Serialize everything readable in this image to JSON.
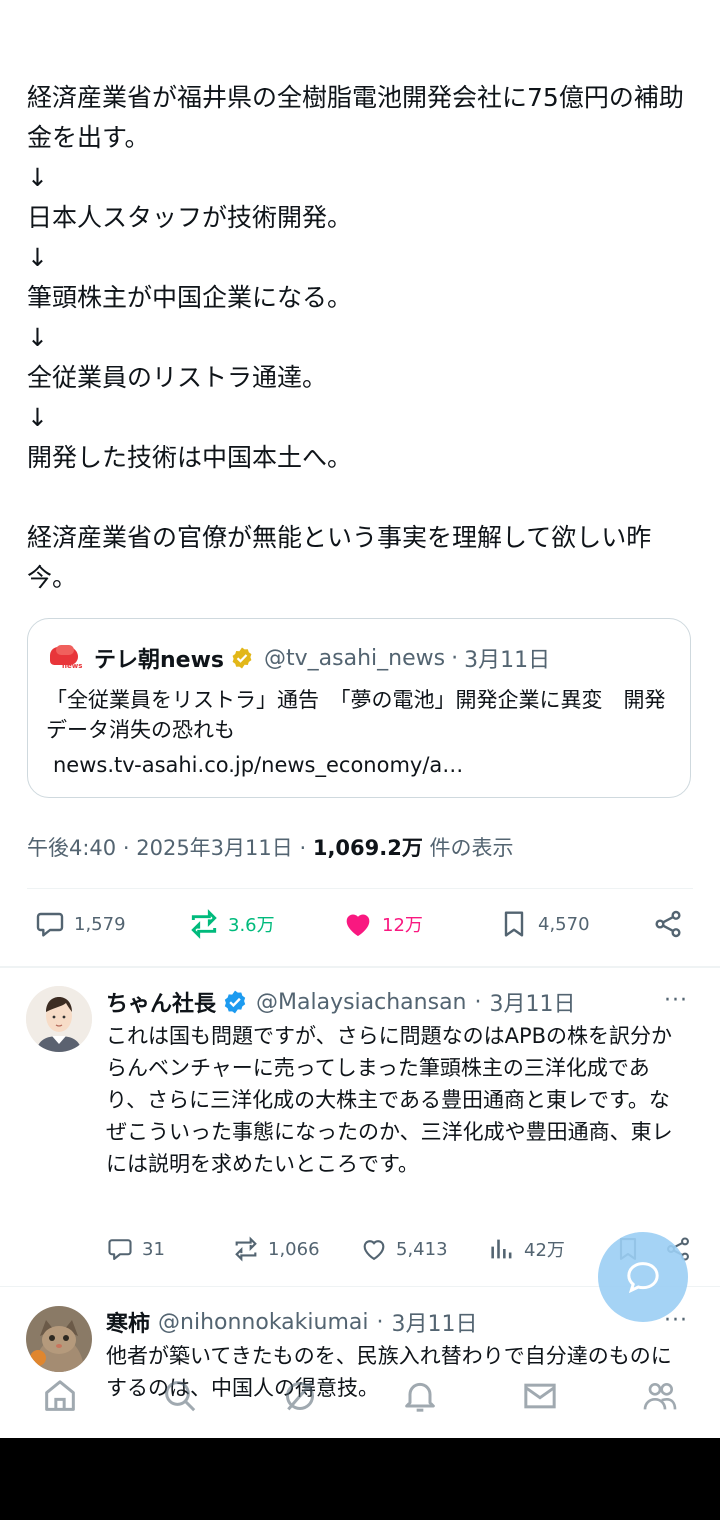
{
  "post": {
    "text": "経済産業省が福井県の全樹脂電池開発会社に75億円の補助金を出す。\n↓\n日本人スタッフが技術開発。\n↓\n筆頭株主が中国企業になる。\n↓\n全従業員のリストラ通達。\n↓\n開発した技術は中国本土へ。\n\n経済産業省の官僚が無能という事実を理解して欲しい昨今。"
  },
  "quote": {
    "logo_text": "news",
    "name": "テレ朝news",
    "handle": "@tv_asahi_news",
    "dot": "·",
    "date": "3月11日",
    "title": "「全従業員をリストラ」通告　「夢の電池」開発企業に異変　開発データ消失の恐れも",
    "url": "news.tv-asahi.co.jp/news_economy/a…"
  },
  "meta": {
    "time": "午後4:40",
    "dot": "·",
    "date": "2025年3月11日",
    "dot2": "·",
    "views": "1,069.2万",
    "views_label": "件の表示"
  },
  "actions": {
    "replies": "1,579",
    "reposts": "3.6万",
    "likes": "12万",
    "bookmarks": "4,570"
  },
  "colors": {
    "repost": "#00ba7c",
    "like": "#f91880",
    "verified": "#1d9bf0",
    "gold": "#e2b719",
    "fab": "#9ccff4"
  },
  "replies": [
    {
      "name": "ちゃん社長",
      "handle": "@Malaysiachansan",
      "dot": "·",
      "date": "3月11日",
      "more": "···",
      "text": "これは国も問題ですが、さらに問題なのはAPBの株を訳分からんベンチャーに売ってしまった筆頭株主の三洋化成であり、さらに三洋化成の大株主である豊田通商と東レです。なぜこういった事態になったのか、三洋化成や豊田通商、東レには説明を求めたいところです。",
      "replies": "31",
      "reposts": "1,066",
      "likes": "5,413",
      "views": "42万"
    },
    {
      "name": "寒柿",
      "handle": "@nihonnokakiumai",
      "dot": "·",
      "date": "3月11日",
      "more": "···",
      "text": "他者が築いてきたものを、民族入れ替わりで自分達のものにするのは、中国人の得意技。"
    }
  ],
  "icons": {
    "nav": [
      "home-icon",
      "search-icon",
      "grok-icon",
      "notifications-icon",
      "messages-icon",
      "communities-icon"
    ],
    "fab": "compose-reply-icon"
  }
}
